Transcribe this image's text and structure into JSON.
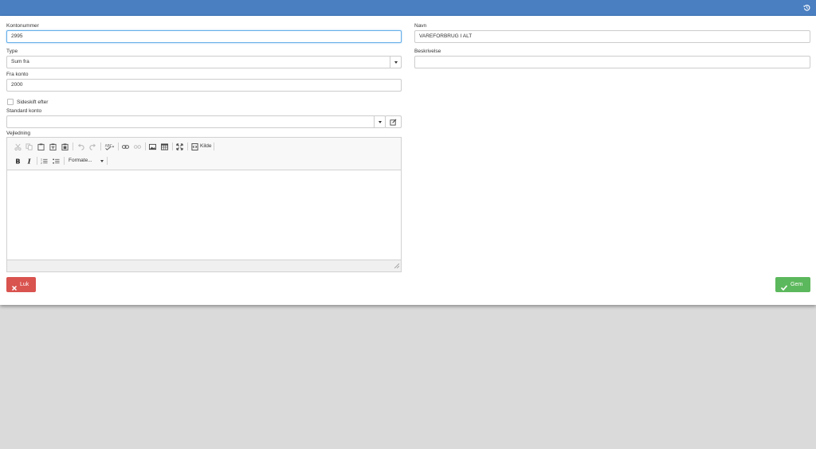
{
  "topbar": {
    "accent": "#4a7fc1",
    "reset_icon": "history-reset-icon"
  },
  "form": {
    "kontonummer": {
      "label": "Kontonummer",
      "value": "2995"
    },
    "navn": {
      "label": "Navn",
      "value": "VAREFORBRUG I ALT"
    },
    "type": {
      "label": "Type",
      "value": "Sum fra"
    },
    "beskrivelse": {
      "label": "Beskrivelse",
      "value": ""
    },
    "fra_konto": {
      "label": "Fra konto",
      "value": "2000"
    },
    "sideskift": {
      "label": "Sideskift efter",
      "checked": false
    },
    "standard_konto": {
      "label": "Standard konto",
      "value": ""
    },
    "vejledning": {
      "label": "Vejledning"
    }
  },
  "editor": {
    "source_label": "Kilde",
    "format_label": "Formate...",
    "icons": [
      "cut-icon",
      "copy-icon",
      "paste-icon",
      "paste-text-icon",
      "paste-word-icon",
      "undo-icon",
      "redo-icon",
      "spellcheck-icon",
      "link-icon",
      "unlink-icon",
      "image-icon",
      "table-icon",
      "maximize-icon",
      "source-icon",
      "bold-icon",
      "italic-icon",
      "numbered-list-icon",
      "bulleted-list-icon"
    ]
  },
  "buttons": {
    "close": {
      "label": "Luk",
      "color": "#d9534f",
      "icon": "close-x-icon"
    },
    "save": {
      "label": "Gem",
      "color": "#5cb85c",
      "icon": "check-icon"
    }
  }
}
